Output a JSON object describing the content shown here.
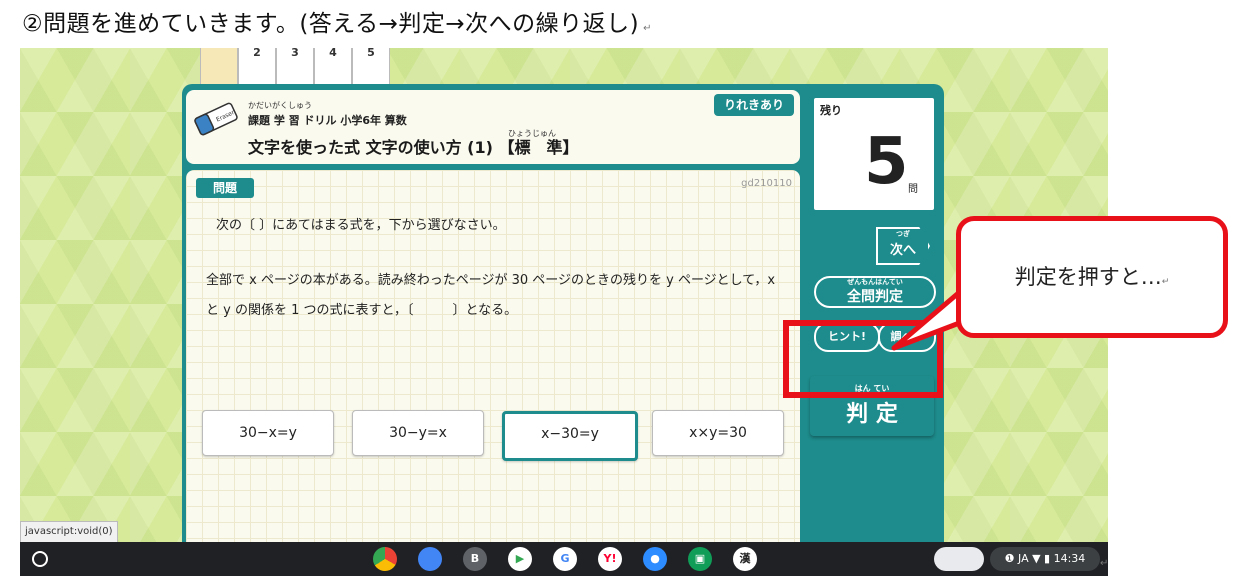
{
  "doc": {
    "heading": "②問題を進めていきます。(答える→判定→次への繰り返し)",
    "return_mark": "↵"
  },
  "tabs": [
    "2",
    "3",
    "4",
    "5"
  ],
  "title_card": {
    "ruby_line": "かだいがくしゅう",
    "subtitle": "課題 学 習 ドリル 小学6年 算数",
    "title_ruby": "ひょうじゅん",
    "lesson_title": "文字を使った式 文字の使い方 (1) 【標　準】",
    "badge": "りれきあり",
    "eraser_label": "Eraser"
  },
  "problem": {
    "label": "問題",
    "id": "gd210110",
    "instruction": "次の〔 〕にあてはまる式を，下から選びなさい。",
    "question": "全部で x ページの本がある。読み終わったページが 30 ページのときの残りを y ページとして，x と y の関係を 1 つの式に表すと，〔　　　〕となる。"
  },
  "choices": [
    {
      "label": "30−x=y",
      "selected": false
    },
    {
      "label": "30−y=x",
      "selected": false
    },
    {
      "label": "x−30=y",
      "selected": true
    },
    {
      "label": "x×y=30",
      "selected": false
    }
  ],
  "side": {
    "remaining_label": "残り",
    "remaining_count": "5",
    "remaining_unit": "問",
    "next_ruby": "つぎ",
    "next_label": "次へ",
    "all_judge_ruby": "ぜんもんはんてい",
    "all_judge_label": "全問判定",
    "hint_label": "ヒント!",
    "lookup_label": "調べる",
    "judge_ruby": "はん てい",
    "judge_label": "判 定"
  },
  "callout": {
    "text": "判定を押すと…",
    "return_mark": "↵"
  },
  "status_url": "javascript:void(0)",
  "shelf": {
    "apps": [
      "chrome",
      "files",
      "B",
      "play",
      "translate",
      "yahoo",
      "zoom",
      "classroom",
      "kanji"
    ],
    "app_letters": {
      "B": "B",
      "yahoo": "Y!",
      "kanji": "漢"
    },
    "status": "❶ JA ▼ ▮ 14:34"
  },
  "colors": {
    "teal": "#1e8c8c",
    "highlight_red": "#e8111a",
    "background_green": "#d7ea9a"
  }
}
